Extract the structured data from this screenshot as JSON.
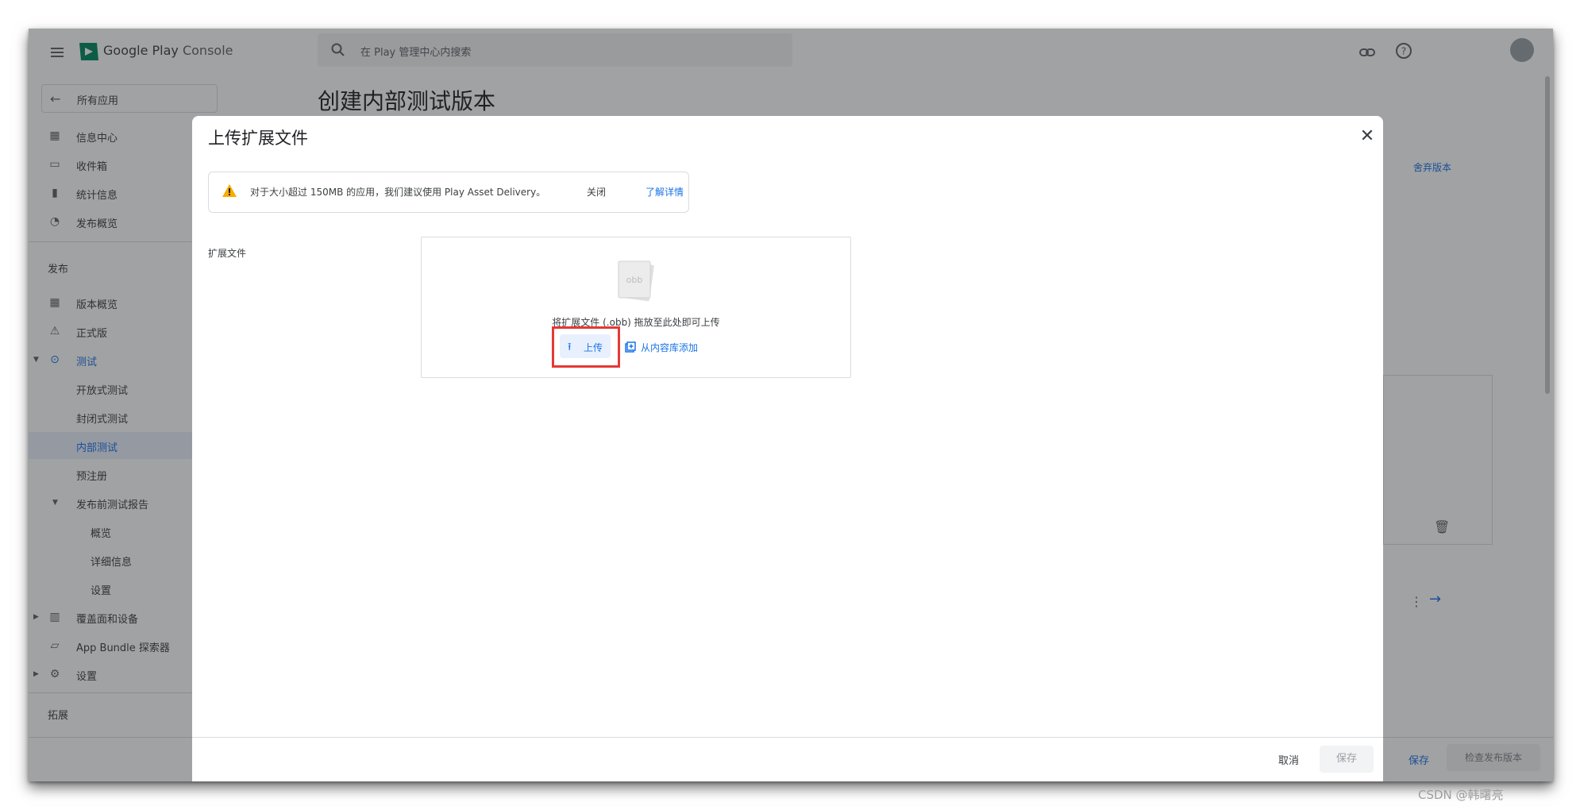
{
  "topbar": {
    "brand_primary": "Google Play",
    "brand_secondary": "Console",
    "search_placeholder": "在 Play 管理中心内搜索"
  },
  "sidebar": {
    "all_apps": "所有应用",
    "items_top": [
      {
        "label": "信息中心",
        "icon": "dashboard-icon"
      },
      {
        "label": "收件箱",
        "icon": "inbox-icon"
      },
      {
        "label": "统计信息",
        "icon": "stats-icon"
      },
      {
        "label": "发布概览",
        "icon": "publishing-overview-icon"
      }
    ],
    "section_release": "发布",
    "items_release": [
      {
        "label": "版本概览",
        "icon": "releases-icon"
      },
      {
        "label": "正式版",
        "icon": "production-icon"
      },
      {
        "label": "测试",
        "icon": "testing-icon"
      }
    ],
    "testing_children": [
      "开放式测试",
      "封闭式测试",
      "内部测试",
      "预注册"
    ],
    "pre_launch": "发布前测试报告",
    "pre_launch_children": [
      "概览",
      "详细信息",
      "设置"
    ],
    "coverage": "覆盖面和设备",
    "bundle_explorer": "App Bundle 探索器",
    "settings": "设置",
    "section_grow": "拓展"
  },
  "main": {
    "page_title": "创建内部测试版本",
    "discard_link": "舍弃版本",
    "save_label": "保存",
    "review_label": "检查发布版本"
  },
  "dialog": {
    "title": "上传扩展文件",
    "notice_message": "对于大小超过 150MB 的应用，我们建议使用 Play Asset Delivery。",
    "notice_close": "关闭",
    "notice_learn_more": "了解详情",
    "field_label": "扩展文件",
    "obb_label": "obb",
    "drop_hint": "将扩展文件 (.obb) 拖放至此处即可上传",
    "upload_label": "上传",
    "library_label": "从内容库添加",
    "cancel_label": "取消",
    "save_label": "保存"
  },
  "watermark": "CSDN @韩曙亮"
}
